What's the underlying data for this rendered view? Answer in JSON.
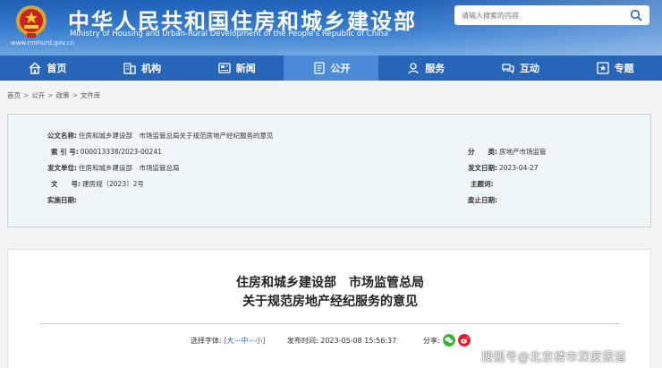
{
  "header": {
    "title": "中华人民共和国住房和城乡建设部",
    "subtitle": "Ministry of Housing and Urban-Rural Development of the People's Republic of China",
    "url": "www.mohurd.gov.cn",
    "search_placeholder": "请输入搜索的内容"
  },
  "nav": {
    "items": [
      {
        "label": "首页",
        "icon": "home-icon"
      },
      {
        "label": "机构",
        "icon": "building-icon"
      },
      {
        "label": "新闻",
        "icon": "news-icon"
      },
      {
        "label": "公开",
        "icon": "open-icon",
        "active": true
      },
      {
        "label": "服务",
        "icon": "service-icon"
      },
      {
        "label": "互动",
        "icon": "interaction-icon"
      },
      {
        "label": "专题",
        "icon": "topic-icon"
      }
    ]
  },
  "breadcrumb": [
    "首页",
    "公开",
    "政策",
    "文件库"
  ],
  "info": {
    "doc_name_label": "公文名称:",
    "doc_name_value": "住房和城乡建设部　市场监管总局关于规范房地产经纪服务的意见",
    "index_label": "索 引 号:",
    "index_value": "000013338/2023-00241",
    "category_label": "分　　类:",
    "category_value": "房地产市场监管",
    "issuer_label": "发文单位:",
    "issuer_value": "住房和城乡建设部　市场监管总局",
    "issue_date_label": "发文日期:",
    "issue_date_value": "2023-04-27",
    "doc_no_label": "文　　号:",
    "doc_no_value": "建房规〔2023〕2号",
    "subject_label": "主题词:",
    "subject_value": "",
    "effective_label": "实施日期:",
    "effective_value": "",
    "repeal_label": "废止日期:",
    "repeal_value": ""
  },
  "article": {
    "title_line1": "住房和城乡建设部　市场监管总局",
    "title_line2": "关于规范房地产经纪服务的意见",
    "font_label": "选择字体:",
    "font_bracket_open": "[",
    "font_large": "大",
    "font_dash1": "－",
    "font_medium": "中",
    "font_dash2": "－",
    "font_small": "小",
    "font_bracket_close": "]",
    "publish_label": "发布时间:",
    "publish_value": "2023-05-08 15:56:37",
    "share_label": "分享:"
  },
  "watermark": "搜狐号@北京楼市深度报道",
  "colors": {
    "header_blue": "#1d5fb4",
    "nav_blue": "#2765b9",
    "nav_active": "#4a8ad6",
    "info_bg": "#eef6fa",
    "wechat_green": "#3cb034",
    "weibo_red": "#e6162d"
  }
}
